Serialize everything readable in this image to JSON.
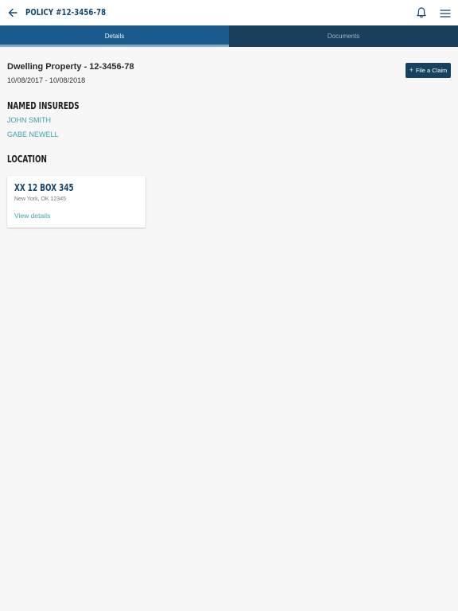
{
  "header": {
    "title": "POLICY #12-3456-78",
    "back_icon": "arrow-left-icon",
    "notification_icon": "bell-icon",
    "menu_icon": "hamburger-menu-icon"
  },
  "tabs": [
    {
      "label": "Details",
      "active": true
    },
    {
      "label": "Documents",
      "active": false
    }
  ],
  "policy": {
    "heading": "Dwelling Property - 12-3456-78",
    "dates": "10/08/2017 - 10/08/2018"
  },
  "actions": {
    "file_claim_label": "File a Claim",
    "file_claim_icon": "plus-icon"
  },
  "named_insureds": {
    "title": "NAMED INSUREDS",
    "people": [
      "JOHN SMITH",
      "GABE NEWELL"
    ]
  },
  "location": {
    "title": "LOCATION",
    "street": "XX 12 BOX 345",
    "city": "New York, OK 12345",
    "link_label": "View details"
  },
  "colors": {
    "primary": "#16415f",
    "active_tab": "#1a5a8c",
    "link": "#3aa3a8",
    "title": "#12466e",
    "background": "#f7f7f7"
  }
}
